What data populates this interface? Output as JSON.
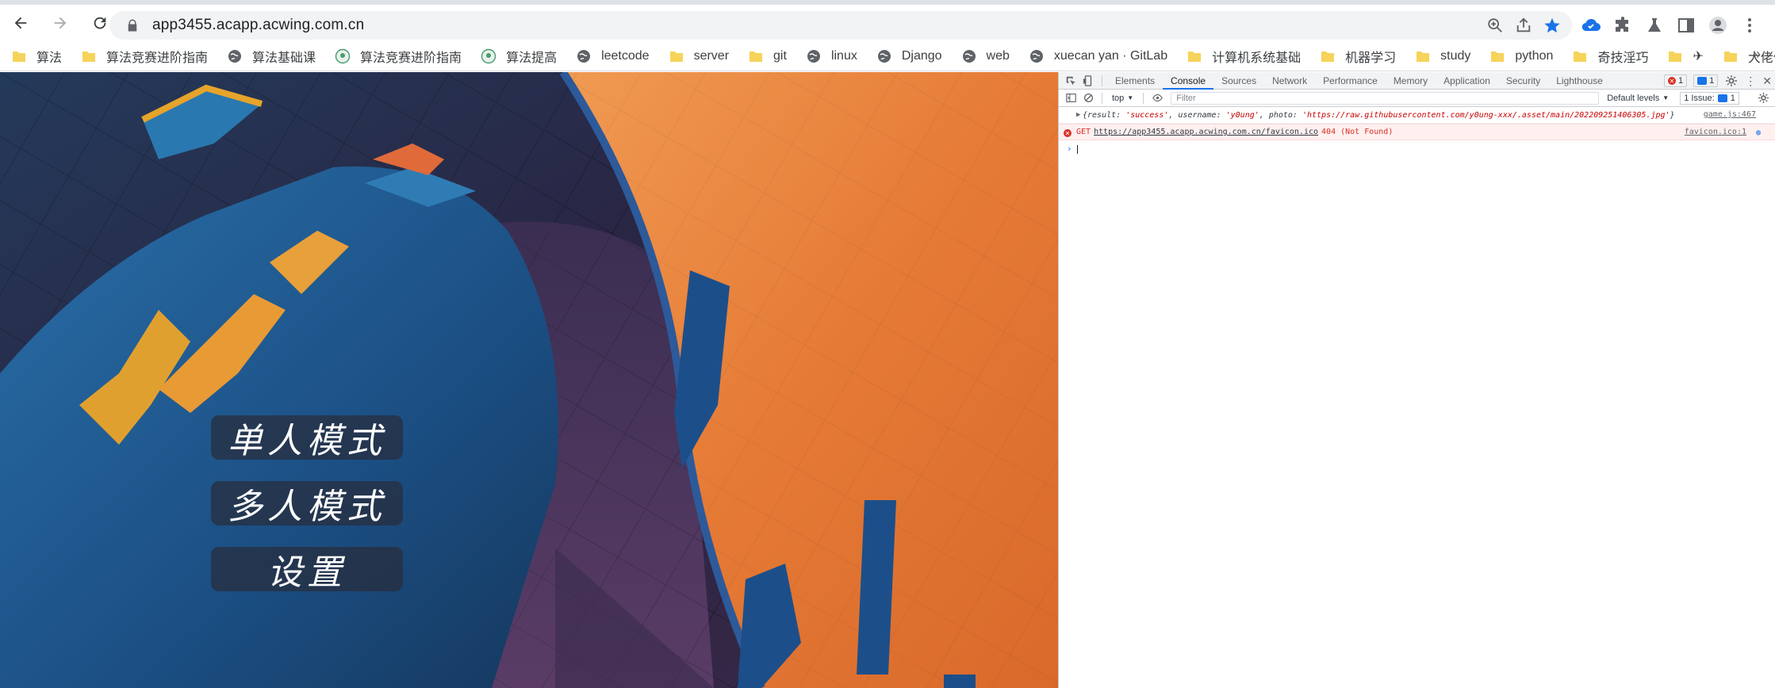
{
  "browser": {
    "url": "app3455.acapp.acwing.com.cn",
    "bookmarks": [
      {
        "label": "算法",
        "icon": "folder-icon"
      },
      {
        "label": "算法竞赛进阶指南",
        "icon": "folder-icon"
      },
      {
        "label": "算法基础课",
        "icon": "globe-icon"
      },
      {
        "label": "算法竞赛进阶指南",
        "icon": "acwing-icon"
      },
      {
        "label": "算法提高",
        "icon": "acwing-icon"
      },
      {
        "label": "leetcode",
        "icon": "globe-icon"
      },
      {
        "label": "server",
        "icon": "folder-icon"
      },
      {
        "label": "git",
        "icon": "folder-icon"
      },
      {
        "label": "linux",
        "icon": "globe-icon"
      },
      {
        "label": "Django",
        "icon": "globe-icon"
      },
      {
        "label": "web",
        "icon": "globe-icon"
      },
      {
        "label": "xuecan yan · GitLab",
        "icon": "globe-icon"
      },
      {
        "label": "计算机系统基础",
        "icon": "folder-icon"
      },
      {
        "label": "机器学习",
        "icon": "folder-icon"
      },
      {
        "label": "study",
        "icon": "folder-icon"
      },
      {
        "label": "python",
        "icon": "folder-icon"
      },
      {
        "label": "奇技淫巧",
        "icon": "folder-icon"
      },
      {
        "label": "✈",
        "icon": "folder-icon"
      },
      {
        "label": "大佬们",
        "icon": "folder-icon"
      }
    ],
    "more": "»"
  },
  "game_menu": {
    "single": "单人模式",
    "multi": "多人模式",
    "settings": "设置"
  },
  "devtools": {
    "tabs": [
      "Elements",
      "Console",
      "Sources",
      "Network",
      "Performance",
      "Memory",
      "Application",
      "Security",
      "Lighthouse"
    ],
    "active_tab": "Console",
    "error_count": "1",
    "message_count": "1",
    "context": "top",
    "filter_placeholder": "Filter",
    "levels": "Default levels",
    "issues_label": "1 Issue:",
    "issues_count": "1",
    "logs": {
      "obj_prefix": "{result: ",
      "result_val": "'success'",
      "username_key": ", username: ",
      "username_val": "'y0ung'",
      "photo_key": ", photo: ",
      "photo_val": "'https://raw.githubusercontent.com/y0ung-xxx/.asset/main/202209251406305.jpg'",
      "obj_suffix": "}",
      "log_source": "game.js:467",
      "err_method": "GET",
      "err_url": "https://app3455.acapp.acwing.com.cn/favicon.ico",
      "err_status": "404 (Not Found)",
      "err_source": "favicon.ico:1"
    }
  },
  "colors": {
    "orange": "#e8843c",
    "blue": "#1f6fa6",
    "devtools_blue": "#1a73e8",
    "error_red": "#d93025"
  }
}
